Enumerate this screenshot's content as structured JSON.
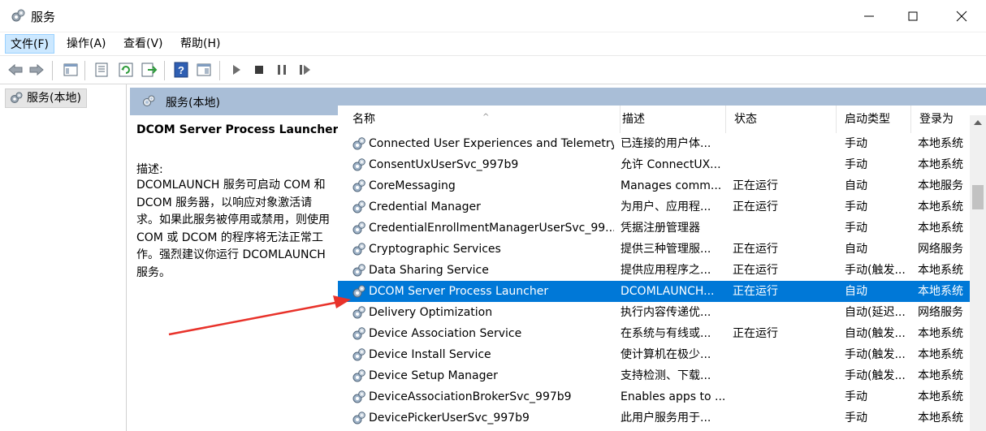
{
  "window": {
    "title": "服务"
  },
  "menu": {
    "items": [
      {
        "label": "文件(F)"
      },
      {
        "label": "操作(A)"
      },
      {
        "label": "查看(V)"
      },
      {
        "label": "帮助(H)"
      }
    ]
  },
  "tree": {
    "root_label": "服务(本地)"
  },
  "pane": {
    "header_label": "服务(本地)"
  },
  "description": {
    "service_title": "DCOM Server Process Launcher",
    "label": "描述:",
    "body": "DCOMLAUNCH 服务可启动 COM 和 DCOM 服务器，以响应对象激活请求。如果此服务被停用或禁用，则使用 COM 或 DCOM 的程序将无法正常工作。强烈建议你运行 DCOMLAUNCH 服务。"
  },
  "table": {
    "columns": [
      {
        "label": "名称"
      },
      {
        "label": "描述"
      },
      {
        "label": "状态"
      },
      {
        "label": "启动类型"
      },
      {
        "label": "登录为"
      }
    ],
    "sort_indicator": "^",
    "rows": [
      {
        "name": "Connected User Experiences and Telemetry",
        "desc": "已连接的用户体...",
        "status": "",
        "start": "手动",
        "logon": "本地系统",
        "selected": false
      },
      {
        "name": "ConsentUxUserSvc_997b9",
        "desc": "允许 ConnectUX...",
        "status": "",
        "start": "手动",
        "logon": "本地系统",
        "selected": false
      },
      {
        "name": "CoreMessaging",
        "desc": "Manages comm...",
        "status": "正在运行",
        "start": "自动",
        "logon": "本地服务",
        "selected": false
      },
      {
        "name": "Credential Manager",
        "desc": "为用户、应用程...",
        "status": "正在运行",
        "start": "手动",
        "logon": "本地系统",
        "selected": false
      },
      {
        "name": "CredentialEnrollmentManagerUserSvc_99...",
        "desc": "凭据注册管理器",
        "status": "",
        "start": "手动",
        "logon": "本地系统",
        "selected": false
      },
      {
        "name": "Cryptographic Services",
        "desc": "提供三种管理服...",
        "status": "正在运行",
        "start": "自动",
        "logon": "网络服务",
        "selected": false
      },
      {
        "name": "Data Sharing Service",
        "desc": "提供应用程序之...",
        "status": "正在运行",
        "start": "手动(触发...",
        "logon": "本地系统",
        "selected": false
      },
      {
        "name": "DCOM Server Process Launcher",
        "desc": "DCOMLAUNCH...",
        "status": "正在运行",
        "start": "自动",
        "logon": "本地系统",
        "selected": true
      },
      {
        "name": "Delivery Optimization",
        "desc": "执行内容传递优...",
        "status": "",
        "start": "自动(延迟...",
        "logon": "网络服务",
        "selected": false
      },
      {
        "name": "Device Association Service",
        "desc": "在系统与有线或...",
        "status": "正在运行",
        "start": "自动(触发...",
        "logon": "本地系统",
        "selected": false
      },
      {
        "name": "Device Install Service",
        "desc": "使计算机在极少...",
        "status": "",
        "start": "手动(触发...",
        "logon": "本地系统",
        "selected": false
      },
      {
        "name": "Device Setup Manager",
        "desc": "支持检测、下载...",
        "status": "",
        "start": "手动(触发...",
        "logon": "本地系统",
        "selected": false
      },
      {
        "name": "DeviceAssociationBrokerSvc_997b9",
        "desc": "Enables apps to ...",
        "status": "",
        "start": "手动",
        "logon": "本地系统",
        "selected": false
      },
      {
        "name": "DevicePickerUserSvc_997b9",
        "desc": "此用户服务用于...",
        "status": "",
        "start": "手动",
        "logon": "本地系统",
        "selected": false
      }
    ]
  },
  "colors": {
    "selection": "#0078d7",
    "pane_header": "#a9bed7",
    "annotation_arrow": "#e8322a"
  }
}
